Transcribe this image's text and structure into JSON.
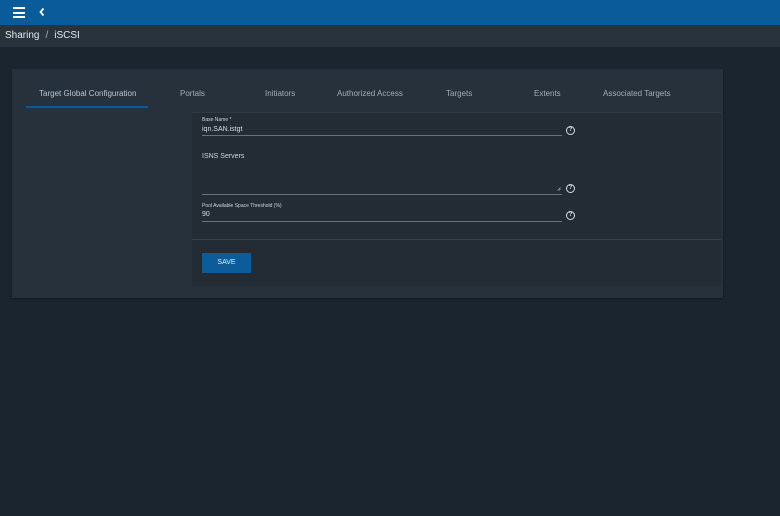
{
  "breadcrumb": {
    "items": [
      "Sharing",
      "iSCSI"
    ],
    "separator": "/"
  },
  "tabs": [
    "Target Global Configuration",
    "Portals",
    "Initiators",
    "Authorized Access",
    "Targets",
    "Extents",
    "Associated Targets"
  ],
  "active_tab": "Target Global Configuration",
  "form": {
    "base_name": {
      "label": "Base Name *",
      "value": "iqn.SAN.istgt"
    },
    "isns_servers": {
      "label": "ISNS Servers",
      "value": ""
    },
    "pool_threshold": {
      "label": "Pool Available Space Threshold (%)",
      "value": "90"
    },
    "help_glyph": "?"
  },
  "actions": {
    "save_label": "SAVE"
  },
  "icons": {
    "menu": "menu-icon",
    "back": "chevron-left-icon",
    "help": "help-circle-icon",
    "resize": "resize-handle-icon"
  },
  "colors": {
    "topbar": "#0a5b9a",
    "background": "#1b2530",
    "card": "#27313b",
    "button": "#0b5c98"
  }
}
